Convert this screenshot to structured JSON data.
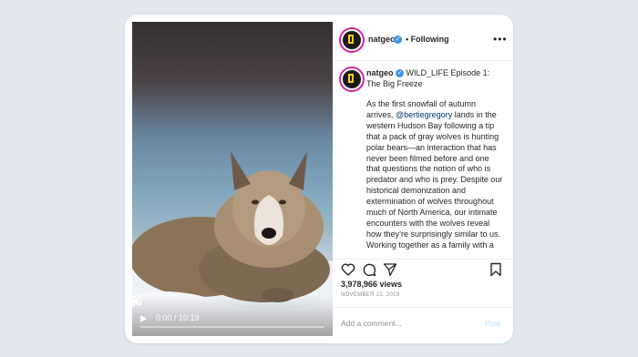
{
  "video": {
    "time": "0:00 / 10:19",
    "icons": [
      "play-icon",
      "volume-icon",
      "fullscreen-icon",
      "more-vertical-icon"
    ]
  },
  "post": {
    "username": "natgeo",
    "follow_label": "• Following",
    "caption_title": "WILD_LIFE Episode 1: The Big Freeze",
    "caption_intro": "As the first snowfall of autumn arrives,",
    "mention": "@bertiegregory",
    "caption_body": "lands in the western Hudson Bay following a tip that a pack of gray wolves is hunting polar bears—an interaction that has never been filmed before and one that questions the notion of who is predator and who is prey. Despite our historical demonization and extermination of wolves throughout much of North America, our intimate encounters with the wolves reveal how they’re surprisingly similar to us. Working together as a family with a fiercely loyal spirit, we see that pack living is key to their success. This strategy is what allows them to survive in this harsh environment.",
    "likes": "3,978,966 views",
    "date": "NOVEMBER 22, 2019"
  },
  "comment": {
    "placeholder": "Add a comment...",
    "post_label": "Post"
  },
  "colors": {
    "verified": "#3897f0",
    "link": "#00376b",
    "post_disabled": "#b2dffc",
    "background": "#dfe9ee"
  }
}
